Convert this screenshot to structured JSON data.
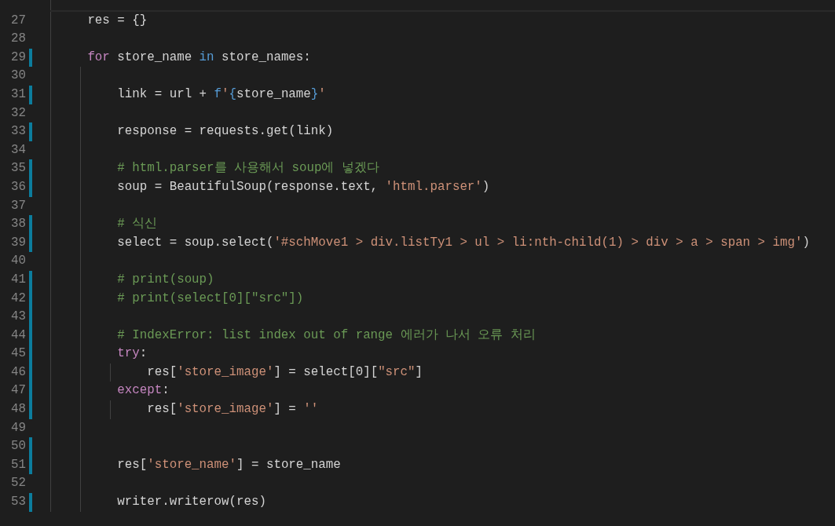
{
  "editor": {
    "lines": [
      {
        "modified": false,
        "current": true
      },
      {
        "number": "27",
        "modified": false,
        "current": false,
        "tokens": [
          {
            "kind": "plain",
            "text": "res = {}"
          }
        ]
      },
      {
        "number": "28",
        "modified": false,
        "current": false
      },
      {
        "number": "29",
        "modified": true,
        "current": false,
        "tokens": [
          {
            "kind": "control",
            "text": "for"
          },
          {
            "kind": "plain",
            "text": " store_name "
          },
          {
            "kind": "keyword",
            "text": "in"
          },
          {
            "kind": "plain",
            "text": " store_names:"
          }
        ],
        "children": [
          {
            "number": "30",
            "modified": false,
            "current": false
          },
          {
            "number": "31",
            "modified": true,
            "current": false,
            "tokens": [
              {
                "kind": "plain",
                "text": "link = url + "
              },
              {
                "kind": "keyword",
                "text": "f"
              },
              {
                "kind": "string",
                "text": "'"
              },
              {
                "kind": "keyword",
                "text": "{"
              },
              {
                "kind": "plain",
                "text": "store_name"
              },
              {
                "kind": "keyword",
                "text": "}"
              },
              {
                "kind": "string",
                "text": "'"
              }
            ]
          },
          {
            "number": "32",
            "modified": false,
            "current": false
          },
          {
            "number": "33",
            "modified": true,
            "current": false,
            "tokens": [
              {
                "kind": "plain",
                "text": "response = requests.get(link)"
              }
            ]
          },
          {
            "number": "34",
            "modified": false,
            "current": false
          },
          {
            "number": "35",
            "modified": true,
            "current": false,
            "tokens": [
              {
                "kind": "comment",
                "text": "# html.parser를 사용해서 soup에 넣겠다"
              }
            ]
          },
          {
            "number": "36",
            "modified": true,
            "current": false,
            "tokens": [
              {
                "kind": "plain",
                "text": "soup = BeautifulSoup(response.text, "
              },
              {
                "kind": "string",
                "text": "'html.parser'"
              },
              {
                "kind": "plain",
                "text": ")"
              }
            ]
          },
          {
            "number": "37",
            "modified": false,
            "current": false
          },
          {
            "number": "38",
            "modified": true,
            "current": false,
            "tokens": [
              {
                "kind": "comment",
                "text": "# 식신"
              }
            ]
          },
          {
            "number": "39",
            "modified": true,
            "current": false,
            "tokens": [
              {
                "kind": "plain",
                "text": "select = soup.select("
              },
              {
                "kind": "string",
                "text": "'#schMove1 > div.listTy1 > ul > li:nth-child(1) > div > a > span > img'"
              },
              {
                "kind": "plain",
                "text": ")"
              }
            ]
          },
          {
            "number": "40",
            "modified": false,
            "current": false
          },
          {
            "number": "41",
            "modified": true,
            "current": false,
            "tokens": [
              {
                "kind": "comment",
                "text": "# print(soup)"
              }
            ]
          },
          {
            "number": "42",
            "modified": true,
            "current": false,
            "tokens": [
              {
                "kind": "comment",
                "text": "# print(select[0][\"src\"])"
              }
            ]
          },
          {
            "number": "43",
            "modified": true,
            "current": false
          },
          {
            "number": "44",
            "modified": true,
            "current": false,
            "tokens": [
              {
                "kind": "comment",
                "text": "# IndexError: list index out of range 에러가 나서 오류 처리"
              }
            ]
          },
          {
            "number": "45",
            "modified": true,
            "current": false,
            "tokens": [
              {
                "kind": "control",
                "text": "try"
              },
              {
                "kind": "plain",
                "text": ":"
              }
            ],
            "children": [
              {
                "number": "46",
                "modified": true,
                "current": false,
                "tokens": [
                  {
                    "kind": "plain",
                    "text": "res["
                  },
                  {
                    "kind": "string",
                    "text": "'store_image'"
                  },
                  {
                    "kind": "plain",
                    "text": "] = select[0]["
                  },
                  {
                    "kind": "string",
                    "text": "\"src\""
                  },
                  {
                    "kind": "plain",
                    "text": "]"
                  }
                ]
              }
            ]
          },
          {
            "number": "47",
            "modified": true,
            "current": false,
            "tokens": [
              {
                "kind": "control",
                "text": "except"
              },
              {
                "kind": "plain",
                "text": ":"
              }
            ],
            "children": [
              {
                "number": "48",
                "modified": true,
                "current": false,
                "tokens": [
                  {
                    "kind": "plain",
                    "text": "res["
                  },
                  {
                    "kind": "string",
                    "text": "'store_image'"
                  },
                  {
                    "kind": "plain",
                    "text": "] = "
                  },
                  {
                    "kind": "string",
                    "text": "''"
                  }
                ]
              }
            ]
          },
          {
            "number": "49",
            "modified": false,
            "current": false
          },
          {
            "number": "50",
            "modified": true,
            "current": false
          },
          {
            "number": "51",
            "modified": true,
            "current": false,
            "tokens": [
              {
                "kind": "plain",
                "text": "res["
              },
              {
                "kind": "string",
                "text": "'store_name'"
              },
              {
                "kind": "plain",
                "text": "] = store_name"
              }
            ]
          },
          {
            "number": "52",
            "modified": false,
            "current": false
          },
          {
            "number": "53",
            "modified": true,
            "current": false,
            "tokens": [
              {
                "kind": "plain",
                "text": "writer.writerow(res)"
              }
            ]
          }
        ]
      }
    ]
  }
}
